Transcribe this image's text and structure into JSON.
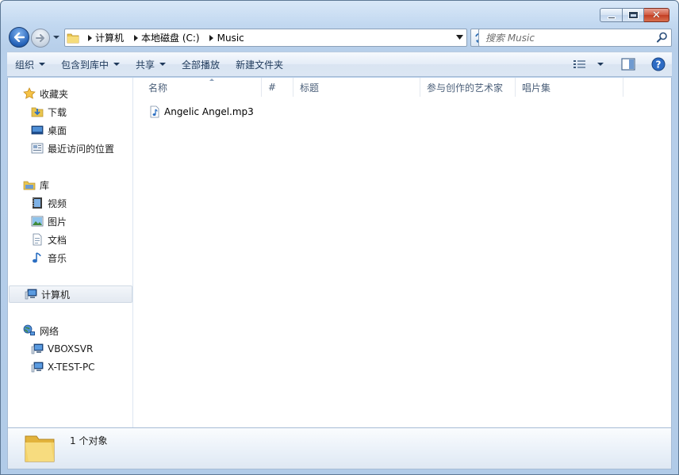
{
  "window": {
    "controls": {
      "minimize": "minimize",
      "maximize": "maximize",
      "close": "✕"
    }
  },
  "address": {
    "crumbs": [
      "计算机",
      "本地磁盘 (C:)",
      "Music"
    ]
  },
  "search": {
    "placeholder": "搜索 Music"
  },
  "toolbar": {
    "organize": "组织",
    "include_library": "包含到库中",
    "share": "共享",
    "play_all": "全部播放",
    "new_folder": "新建文件夹"
  },
  "navpane": {
    "favorites": {
      "label": "收藏夹",
      "items": [
        "下载",
        "桌面",
        "最近访问的位置"
      ]
    },
    "libraries": {
      "label": "库",
      "items": [
        "视频",
        "图片",
        "文档",
        "音乐"
      ]
    },
    "computer": {
      "label": "计算机"
    },
    "network": {
      "label": "网络",
      "items": [
        "VBOXSVR",
        "X-TEST-PC"
      ]
    }
  },
  "columns": [
    "名称",
    "#",
    "标题",
    "参与创作的艺术家",
    "唱片集"
  ],
  "files": [
    {
      "name": "Angelic Angel.mp3",
      "icon": "music-file-icon"
    }
  ],
  "details": {
    "status": "1 个对象"
  },
  "colors": {
    "accent": "#1e395b",
    "frame": "#b7cfea",
    "header_text": "#4c607a"
  }
}
